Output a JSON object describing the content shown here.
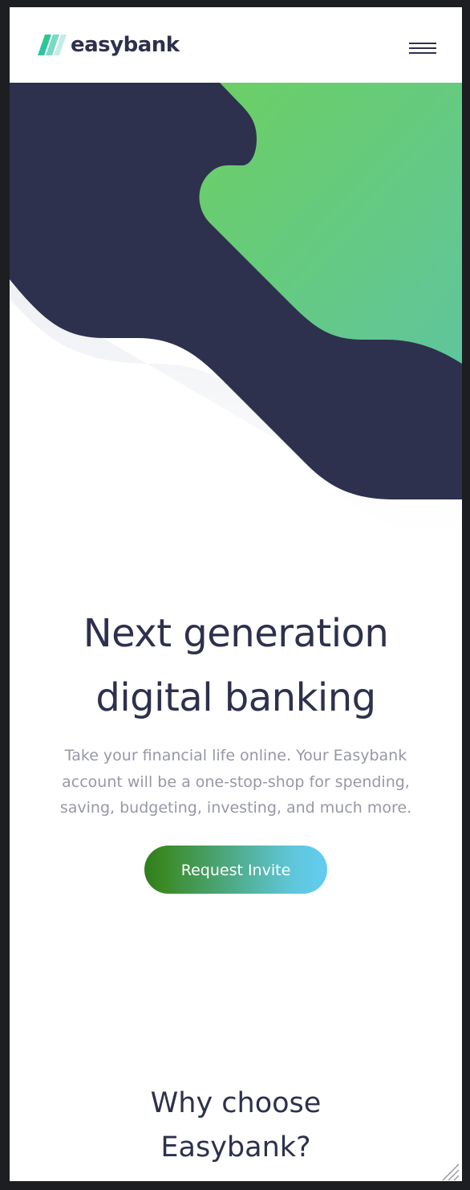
{
  "brand": {
    "name": "easybank"
  },
  "nav": {
    "menu_icon": "hamburger-icon"
  },
  "hero": {
    "title_line1": "Next generation",
    "title_line2": "digital banking",
    "description": "Take your financial life online. Your Easybank account will be a one-stop-shop for spending, saving, budgeting, investing, and much more.",
    "cta_label": "Request Invite"
  },
  "why": {
    "title_line1": "Why choose",
    "title_line2": "Easybank?"
  },
  "colors": {
    "dark_blue": "#2d314d",
    "lime_green": "#31d35c",
    "bright_cyan": "#2bb7da",
    "grayish_blue": "#9698a6"
  }
}
